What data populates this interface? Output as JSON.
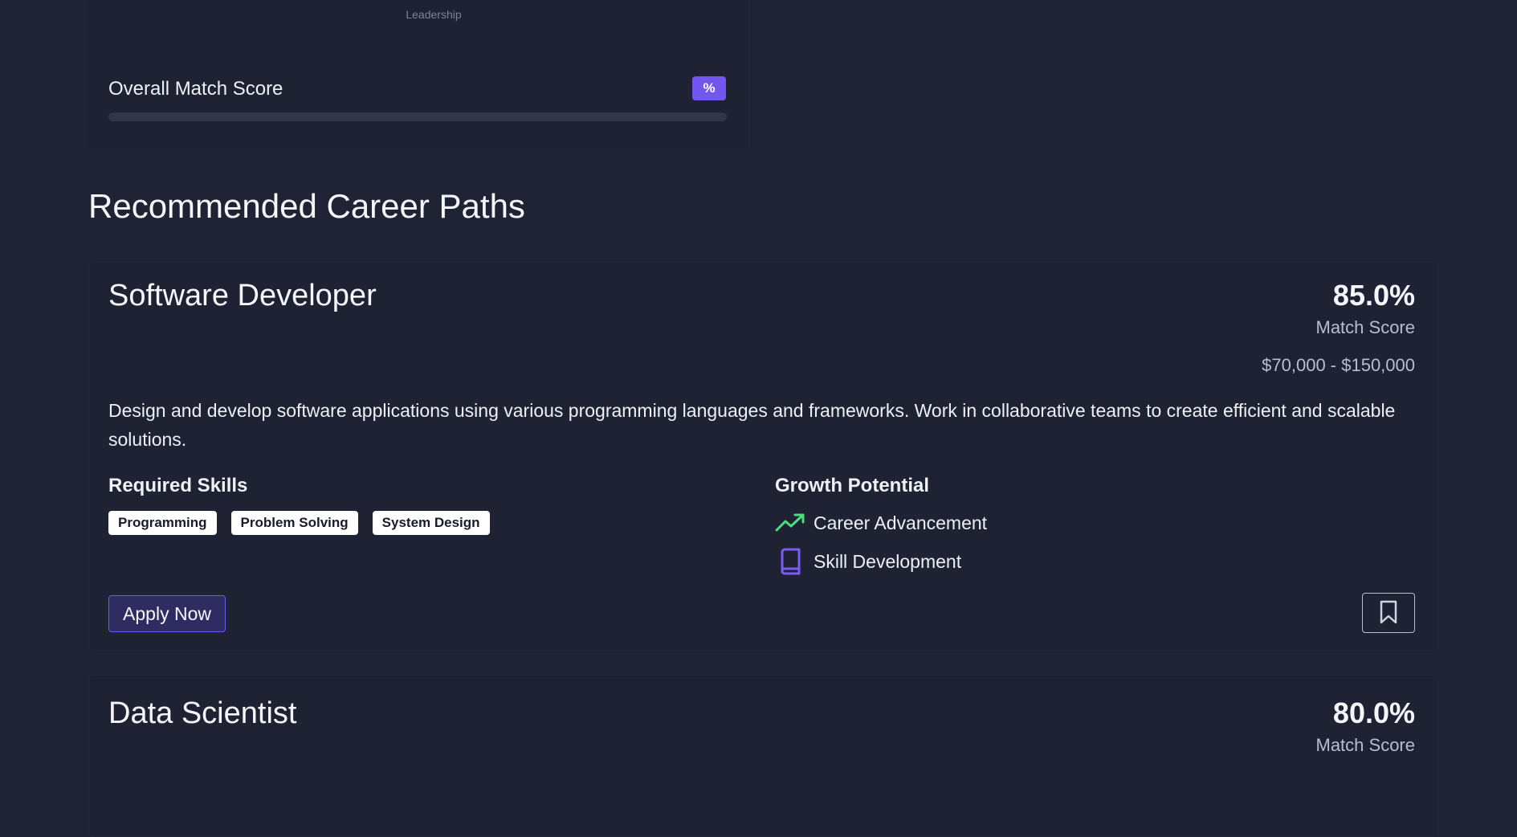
{
  "skills_chart": {
    "category_label": "Leadership"
  },
  "overall": {
    "label": "Overall Match Score",
    "badge": "%",
    "progress_fraction": 0
  },
  "section": {
    "title": "Recommended Career Paths"
  },
  "careers": [
    {
      "title": "Software Developer",
      "score": "85.0%",
      "score_label": "Match Score",
      "salary": "$70,000 - $150,000",
      "description": "Design and develop software applications using various programming languages and frameworks. Work in collaborative teams to create efficient and scalable solutions.",
      "skills_heading": "Required Skills",
      "skills": [
        "Programming",
        "Problem Solving",
        "System Design"
      ],
      "growth_heading": "Growth Potential",
      "growth": [
        {
          "label": "Career Advancement",
          "icon": "trending-up-icon",
          "color": "#4ade80"
        },
        {
          "label": "Skill Development",
          "icon": "book-icon",
          "color": "#7c5cf5"
        }
      ],
      "apply_label": "Apply Now",
      "bookmark_icon": "bookmark-icon"
    },
    {
      "title": "Data Scientist",
      "score": "80.0%",
      "score_label": "Match Score"
    }
  ],
  "colors": {
    "background": "#1f2333",
    "accent": "#7157ef",
    "growth_green": "#4ade80",
    "text": "#e9ebf2",
    "muted": "#b9bece"
  }
}
